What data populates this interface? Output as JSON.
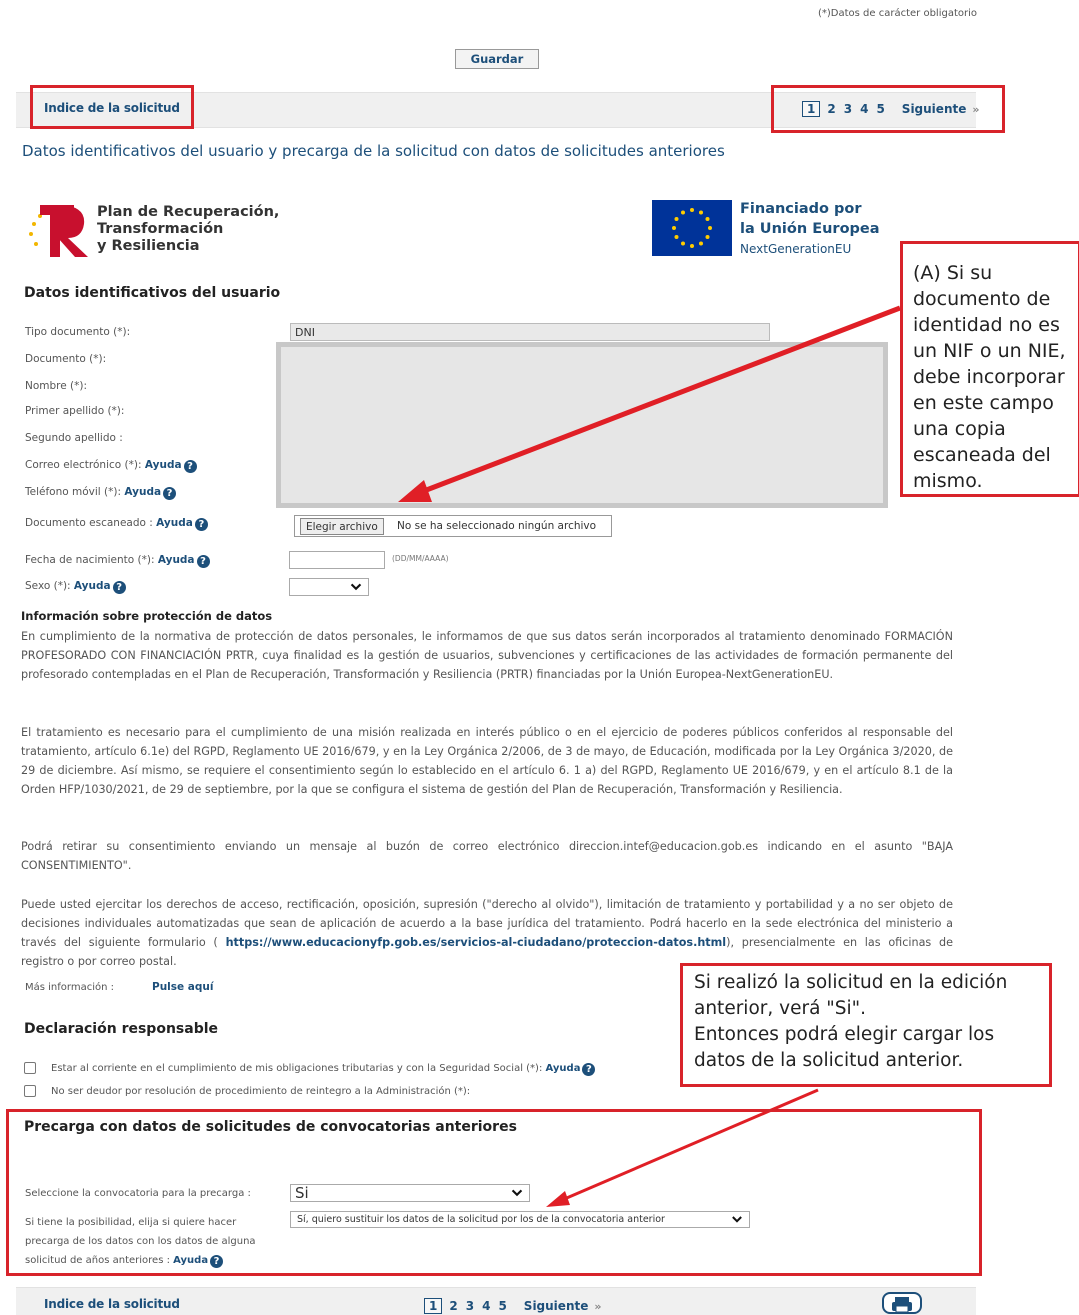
{
  "header": {
    "required_note": "(*)Datos de carácter obligatorio",
    "save_label": "Guardar"
  },
  "nav_top": {
    "index_label": "Indice de la solicitud",
    "pages": [
      "1",
      "2",
      "3",
      "4",
      "5"
    ],
    "current_page": "1",
    "next_label": "Siguiente",
    "next_icon": "double-chevron-right"
  },
  "page_title": "Datos identificativos del usuario y precarga de la solicitud con datos de solicitudes anteriores",
  "logos": {
    "prtr_line1": "Plan de Recuperación,",
    "prtr_line2": "Transformación",
    "prtr_line3": "y Resiliencia",
    "eu_line1": "Financiado por",
    "eu_line2": "la Unión Europea",
    "eu_line3": "NextGenerationEU"
  },
  "user_section": {
    "title": "Datos identificativos del usuario",
    "labels": {
      "doc_type": "Tipo documento (*):",
      "doc": "Documento (*):",
      "name": "Nombre (*):",
      "surname1": "Primer apellido (*):",
      "surname2": "Segundo apellido :",
      "email": "Correo electrónico (*):",
      "phone": "Teléfono móvil (*):",
      "scanned": "Documento escaneado :",
      "birth": "Fecha de nacimiento (*):",
      "sex": "Sexo (*):"
    },
    "help_label": "Ayuda",
    "doc_type_value": "DNI",
    "file_button": "Elegir archivo",
    "file_status": "No se ha seleccionado ningún archivo",
    "date_hint": "(DD/MM/AAAA)",
    "birth_value": "",
    "sex_value": ""
  },
  "privacy": {
    "title": "Información sobre protección de datos",
    "p1": "En cumplimiento de la normativa de protección de datos personales, le informamos de que sus datos serán incorporados al tratamiento denominado FORMACIÓN PROFESORADO CON FINANCIACIÓN PRTR, cuya finalidad es la gestión de usuarios, subvenciones y certificaciones de las actividades de formación permanente del profesorado contempladas en el Plan de Recuperación, Transformación y Resiliencia (PRTR) financiadas por la Unión Europea-NextGenerationEU.",
    "p2": "El tratamiento es necesario para el cumplimiento de una misión realizada en interés público o en el ejercicio de poderes públicos conferidos al responsable del tratamiento, artículo 6.1e) del RGPD, Reglamento UE 2016/679, y en la Ley Orgánica 2/2006, de 3 de mayo, de Educación, modificada por la Ley Orgánica 3/2020, de 29 de diciembre. Así mismo, se requiere el consentimiento según lo establecido en el artículo 6. 1 a) del RGPD, Reglamento UE 2016/679, y en el artículo 8.1 de la Orden HFP/1030/2021, de 29 de septiembre, por la que se configura el sistema de gestión del Plan de Recuperación, Transformación y Resiliencia.",
    "p3": "Podrá retirar su consentimiento enviando un mensaje al buzón de correo electrónico direccion.intef@educacion.gob.es indicando en el asunto \"BAJA CONSENTIMIENTO\".",
    "p4_start": "Puede usted ejercitar los derechos de acceso, rectificación, oposición, supresión (\"derecho al olvido\"), limitación de tratamiento y portabilidad y a no ser objeto de decisiones individuales automatizadas que sean de aplicación de acuerdo a la base jurídica del tratamiento. Podrá hacerlo en la sede electrónica del ministerio a través del siguiente formulario ( ",
    "p4_link": "https://www.educacionyfp.gob.es/servicios-al-ciudadano/proteccion-datos.html",
    "p4_end": "), presencialmente en las oficinas de registro o por correo postal.",
    "more_info_label": "Más información :",
    "more_info_link": "Pulse aquí"
  },
  "declaration": {
    "title": "Declaración responsable",
    "item1": "Estar al corriente en el cumplimiento de mis obligaciones tributarias y con la Seguridad Social (*):",
    "item2": "No ser deudor por resolución de procedimiento de reintegro a la Administración (*):",
    "help_label": "Ayuda"
  },
  "preload": {
    "title": "Precarga con datos de solicitudes de convocatorias anteriores",
    "select_label": "Seleccione la convocatoria para la precarga :",
    "select_value": "Si",
    "option_label_1": "Si tiene la posibilidad, elija si quiere hacer",
    "option_label_2": "precarga de los datos con los datos de alguna",
    "option_label_3": "solicitud de años anteriores :",
    "help_label": "Ayuda",
    "option_value": "Sí, quiero sustituir los datos de la solicitud por los de la convocatoria anterior"
  },
  "nav_bottom": {
    "index_label": "Indice de la solicitud",
    "pages": [
      "1",
      "2",
      "3",
      "4",
      "5"
    ],
    "current_page": "1",
    "next_label": "Siguiente",
    "print_icon": "printer-icon"
  },
  "callouts": {
    "a": "(A) Si su documento de identidad no es un NIF o un NIE, debe incorporar en este campo una copia escaneada del mismo.",
    "b_line1": "Si realizó la solicitud en la edición anterior, verá \"Si\".",
    "b_line2": "Entonces podrá elegir cargar los datos de la solicitud anterior."
  },
  "colors": {
    "annotation_red": "#d8232a",
    "link_blue": "#1d4f7a",
    "eu_blue": "#003399",
    "eu_yellow": "#ffcc00"
  }
}
